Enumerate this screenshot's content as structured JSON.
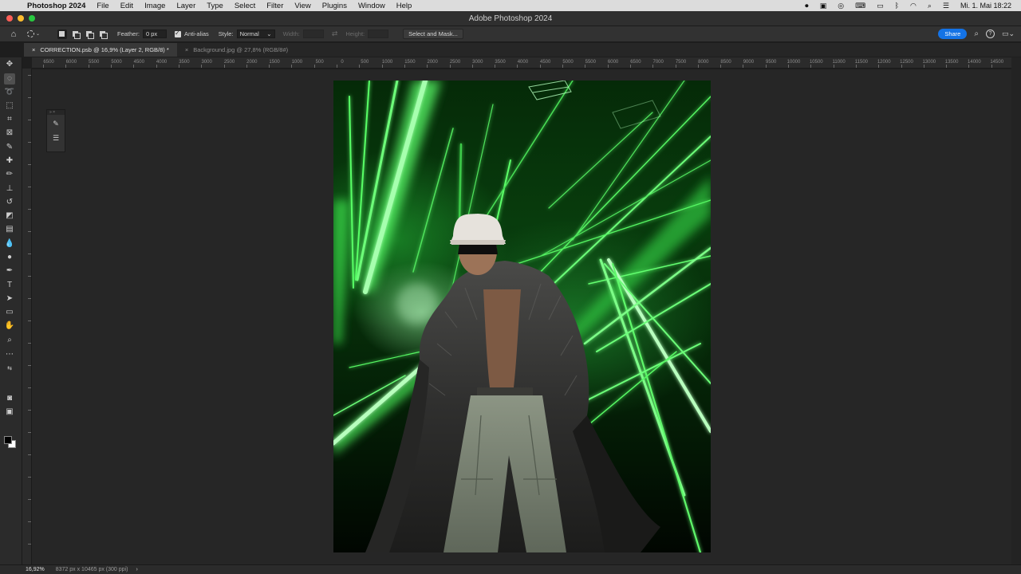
{
  "menubar": {
    "app_name": "Photoshop 2024",
    "items": [
      "File",
      "Edit",
      "Image",
      "Layer",
      "Type",
      "Select",
      "Filter",
      "View",
      "Plugins",
      "Window",
      "Help"
    ],
    "clock": "Mi. 1. Mai 18:22"
  },
  "window": {
    "title": "Adobe Photoshop 2024"
  },
  "options": {
    "feather_label": "Feather:",
    "feather_value": "0 px",
    "antialias_label": "Anti-alias",
    "style_label": "Style:",
    "style_value": "Normal",
    "width_label": "Width:",
    "height_label": "Height:",
    "select_mask_label": "Select and Mask...",
    "share_label": "Share"
  },
  "tabs": [
    {
      "label": "CORRECTION.psb @ 16,9% (Layer 2, RGB/8) *",
      "active": true
    },
    {
      "label": "Background.jpg @ 27,8% (RGB/8#)",
      "active": false
    }
  ],
  "ruler": {
    "labels": [
      "6500",
      "6000",
      "5500",
      "5000",
      "4500",
      "4000",
      "3500",
      "3000",
      "2500",
      "2000",
      "1500",
      "1000",
      "500",
      "0",
      "500",
      "1000",
      "1500",
      "2000",
      "2500",
      "3000",
      "3500",
      "4000",
      "4500",
      "5000",
      "5500",
      "6000",
      "6500",
      "7000",
      "7500",
      "8000",
      "8500",
      "9000",
      "9500",
      "10000",
      "10500",
      "11000",
      "11500",
      "12000",
      "12500",
      "13000",
      "13500",
      "14000",
      "14500"
    ]
  },
  "status": {
    "zoom": "16,92%",
    "doc_info": "8372 px x 10465 px (300 ppi)"
  }
}
